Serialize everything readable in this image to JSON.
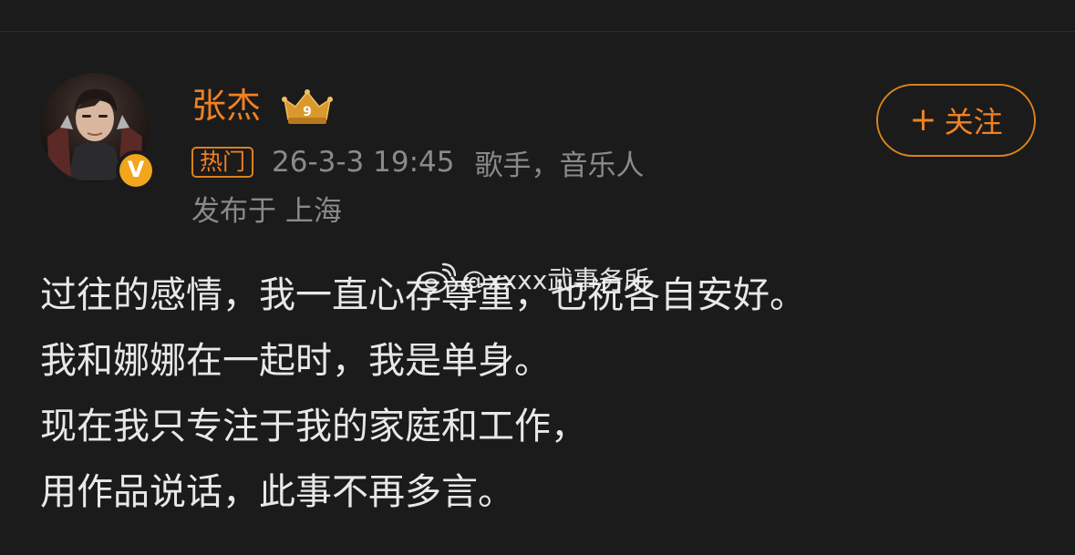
{
  "post": {
    "author": {
      "name": "张杰",
      "rank_badge_level": "9",
      "verified_badge": "V"
    },
    "hot_tag": "热门",
    "timestamp": "26-3-3 19:45",
    "profession": "歌手，音乐人",
    "location": "发布于 上海",
    "follow_button": {
      "icon": "+",
      "label": "关注"
    },
    "lines": [
      "过往的感情，我一直心存尊重，也祝各自安好。",
      "我和娜娜在一起时，我是单身。",
      "现在我只专注于我的家庭和工作，",
      "用作品说话，此事不再多言。"
    ]
  },
  "watermark": {
    "icon": "weibo-icon",
    "text": "@xxxx武事务所"
  },
  "colors": {
    "background": "#1b1b1b",
    "accent": "#f08223",
    "secondary_text": "#8a8a8a",
    "body_text": "#e8e8e8",
    "verified": "#f2a61d"
  }
}
